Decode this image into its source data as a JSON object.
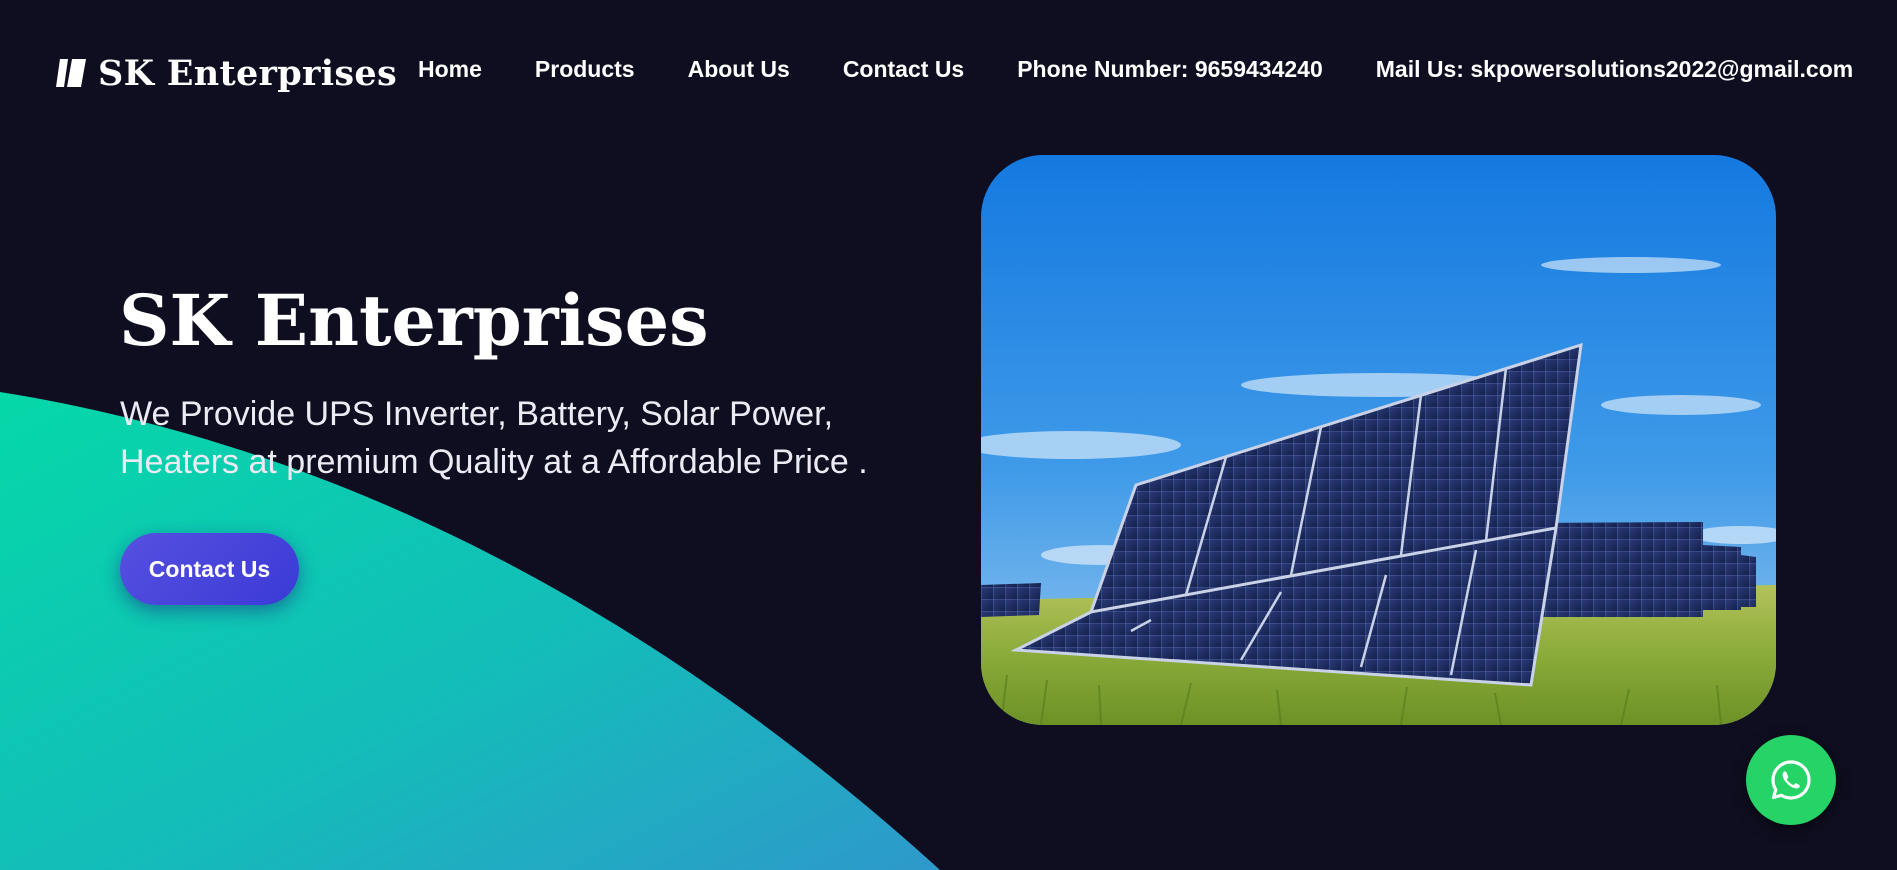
{
  "brand": {
    "name": "SK Enterprises",
    "logo_icon": "bolt-logo-icon"
  },
  "nav": {
    "items": [
      {
        "label": "Home"
      },
      {
        "label": "Products"
      },
      {
        "label": "About Us"
      },
      {
        "label": "Contact Us"
      }
    ],
    "phone": "Phone Number: 9659434240",
    "mail": "Mail Us: skpowersolutions2022@gmail.com"
  },
  "hero": {
    "title": "SK Enterprises",
    "subtitle_line1": "We Provide UPS Inverter, Battery, Solar Power,",
    "subtitle_line2": "Heaters at premium Quality at a Affordable Price .",
    "cta_label": "Contact Us",
    "image_icon": "solar-panels-photo"
  },
  "floating": {
    "whatsapp_icon": "whatsapp-icon"
  },
  "colors": {
    "background": "#0e0e20",
    "wave_start": "#05d8a8",
    "wave_end": "#2e99cb",
    "cta": "#4a45dc",
    "whatsapp": "#25d366"
  }
}
